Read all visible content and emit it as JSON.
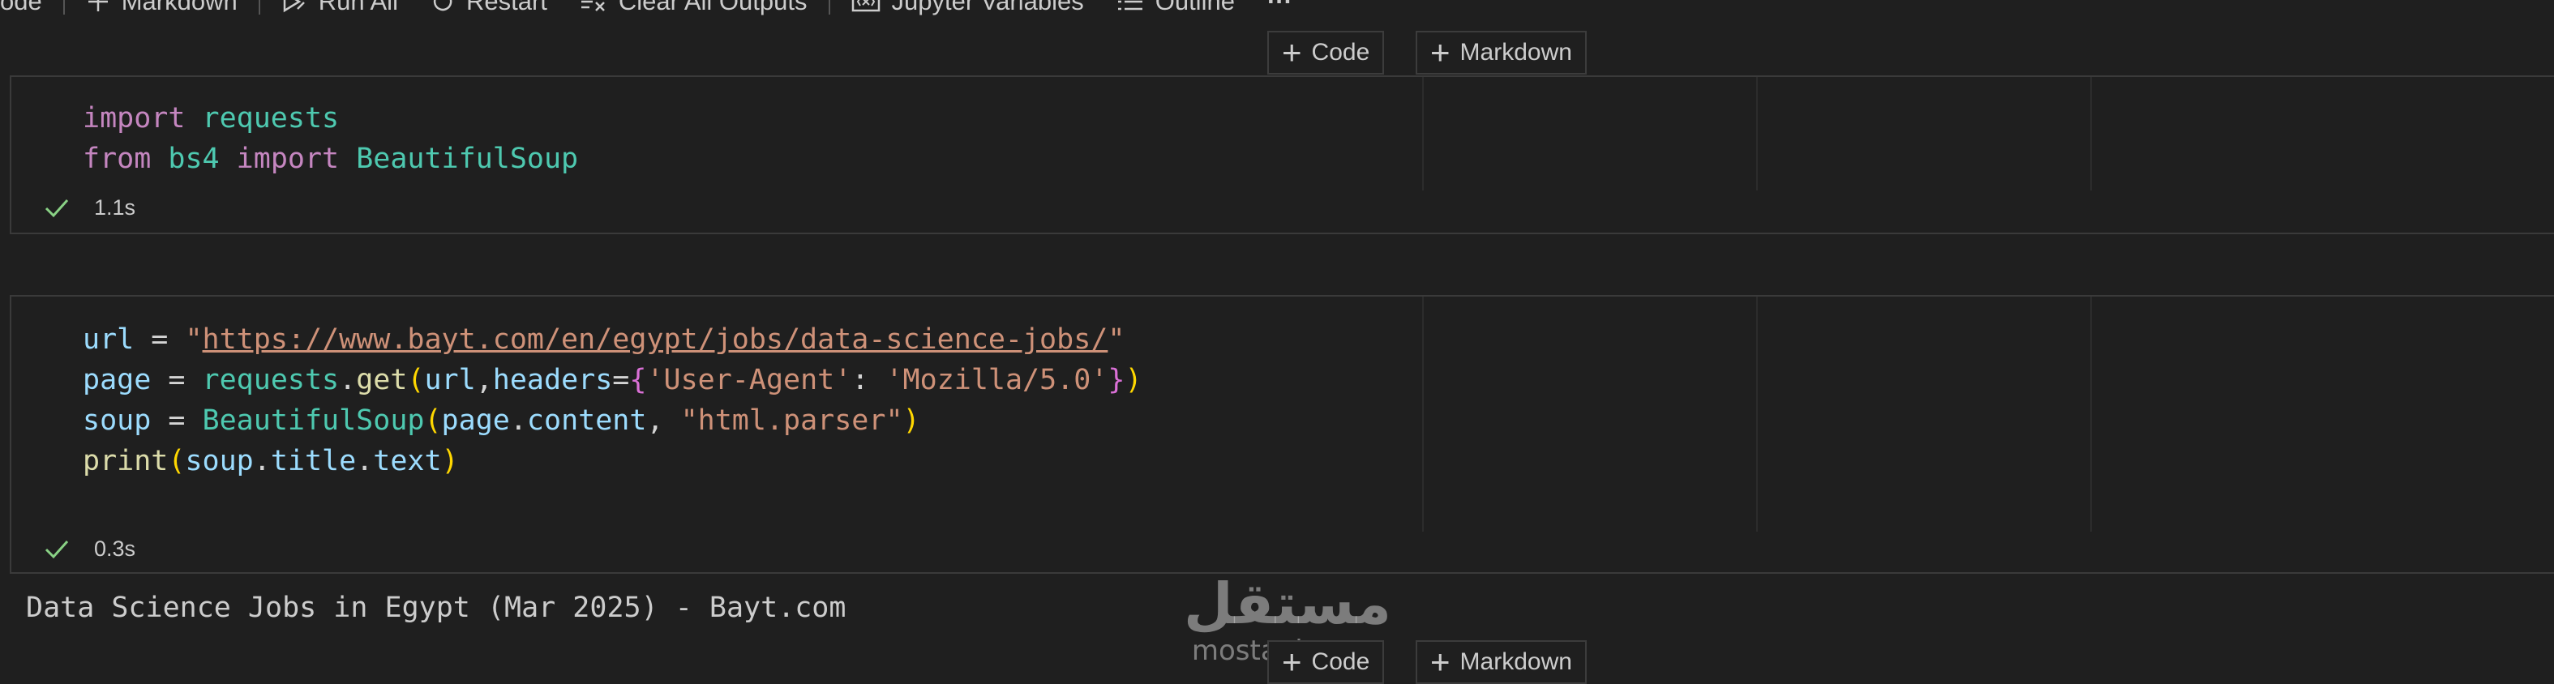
{
  "toolbar": {
    "items": [
      {
        "label": "ode",
        "icon": "none"
      },
      {
        "label": "Markdown",
        "icon": "plus-icon"
      },
      {
        "label": "Run All",
        "icon": "run-all-icon"
      },
      {
        "label": "Restart",
        "icon": "restart-icon"
      },
      {
        "label": "Clear All Outputs",
        "icon": "clear-all-icon"
      },
      {
        "label": "Jupyter Variables",
        "icon": "variables-icon"
      },
      {
        "label": "Outline",
        "icon": "outline-icon"
      },
      {
        "label": "···",
        "icon": "more-icon"
      }
    ]
  },
  "add_cell": {
    "code_label": "Code",
    "markdown_label": "Markdown"
  },
  "cells": [
    {
      "lines": [
        "import requests",
        "from bs4 import BeautifulSoup"
      ],
      "status": "1.1s"
    },
    {
      "lines": [
        "url = \"https://www.bayt.com/en/egypt/jobs/data-science-jobs/\"",
        "page = requests.get(url,headers={'User-Agent': 'Mozilla/5.0'})",
        "soup = BeautifulSoup(page.content, \"html.parser\")",
        "print(soup.title.text)"
      ],
      "status": "0.3s",
      "output": "Data Science Jobs in Egypt (Mar 2025) - Bayt.com"
    }
  ],
  "watermark": {
    "arabic": "مستقل",
    "latin": "mostaql.com"
  },
  "colors": {
    "background": "#1f1f1f",
    "keyword": "#c586c0",
    "module": "#4ec9b0",
    "variable": "#9cdcfe",
    "function": "#dcdcaa",
    "string": "#ce9178",
    "success": "#89d185"
  }
}
